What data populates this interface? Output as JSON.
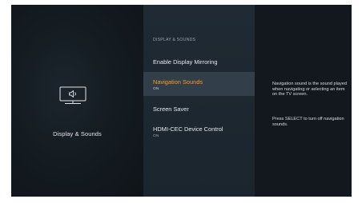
{
  "category": {
    "icon": "tv-speaker-icon",
    "label": "Display & Sounds"
  },
  "menu": {
    "section_title": "DISPLAY & SOUNDS",
    "items": [
      {
        "label": "Enable Display Mirroring",
        "sub": ""
      },
      {
        "label": "Navigation Sounds",
        "sub": "ON"
      },
      {
        "label": "Screen Saver",
        "sub": ""
      },
      {
        "label": "HDMI-CEC Device Control",
        "sub": "ON"
      }
    ],
    "selected_index": 1
  },
  "description": {
    "paragraph1": "Navigation sound is the sound played when navigating or selecting an item on the TV screen.",
    "paragraph2": "Press SELECT to turn off navigation sounds."
  },
  "colors": {
    "accent": "#ff9c1c",
    "selected_row": "#323e49",
    "menu_background": "#1f2a34",
    "background": "#11171c"
  }
}
